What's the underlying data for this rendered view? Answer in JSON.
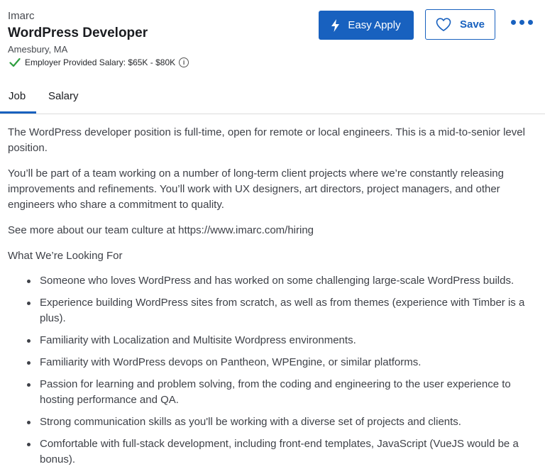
{
  "company": "Imarc",
  "job_title": "WordPress Developer",
  "location": "Amesbury, MA",
  "salary": {
    "label": "Employer Provided Salary:",
    "value": "$65K - $80K",
    "info_icon": "i"
  },
  "actions": {
    "easy_apply": "Easy Apply",
    "save": "Save"
  },
  "tabs": [
    {
      "label": "Job",
      "active": true
    },
    {
      "label": "Salary",
      "active": false
    }
  ],
  "description": {
    "paragraphs": [
      "The WordPress developer position is full-time, open for remote or local engineers. This is a mid-to-senior level position.",
      "You’ll be part of a team working on a number of long-term client projects where we’re constantly releasing improvements and refinements. You’ll work with UX designers, art directors, project managers, and other engineers who share a commitment to quality.",
      "See more about our team culture at https://www.imarc.com/hiring"
    ],
    "heading": "What We’re Looking For",
    "bullets": [
      "Someone who loves WordPress and has worked on some challenging large-scale WordPress builds.",
      "Experience building WordPress sites from scratch, as well as from themes (experience with Timber is a plus).",
      "Familiarity with Localization and Multisite Wordpress environments.",
      "Familiarity with WordPress devops on Pantheon, WPEngine, or similar platforms.",
      "Passion for learning and problem solving, from the coding and engineering to the user experience to hosting performance and QA.",
      "Strong communication skills as you'll be working with a diverse set of projects and clients.",
      "Comfortable with full-stack development, including front-end templates, JavaScript (VueJS would be a bonus)."
    ]
  },
  "colors": {
    "accent": "#1861bf",
    "check": "#2e9e3f",
    "text": "#3e4148"
  }
}
